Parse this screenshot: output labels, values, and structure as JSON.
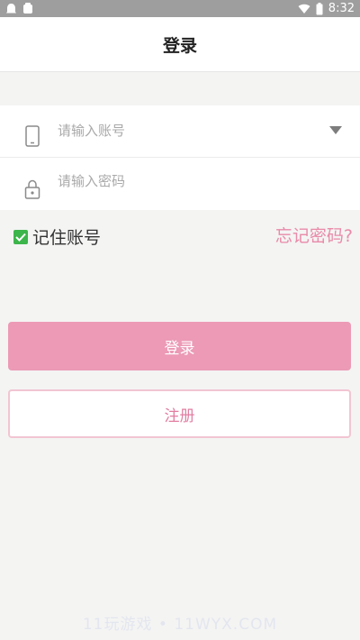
{
  "status_bar": {
    "time": "8:32",
    "left_icons": [
      "notification-icon",
      "app-icon"
    ],
    "right_icons": [
      "wifi-icon",
      "battery-icon"
    ]
  },
  "header": {
    "title": "登录"
  },
  "form": {
    "account": {
      "placeholder": "请输入账号",
      "value": "",
      "icon": "phone-icon",
      "dropdown_icon": "dropdown-arrow-icon"
    },
    "password": {
      "placeholder": "请输入密码",
      "value": "",
      "icon": "lock-icon"
    }
  },
  "options": {
    "remember_label": "记住账号",
    "remember_checked": true,
    "forgot_label": "忘记密码?"
  },
  "actions": {
    "login_label": "登录",
    "register_label": "注册"
  },
  "watermark": "11玩游戏 • 11WYX.COM",
  "colors": {
    "accent": "#ec9ab6",
    "accent_text": "#e17ea2",
    "checkbox": "#3cb54a",
    "status_bar": "#9e9e9e"
  }
}
